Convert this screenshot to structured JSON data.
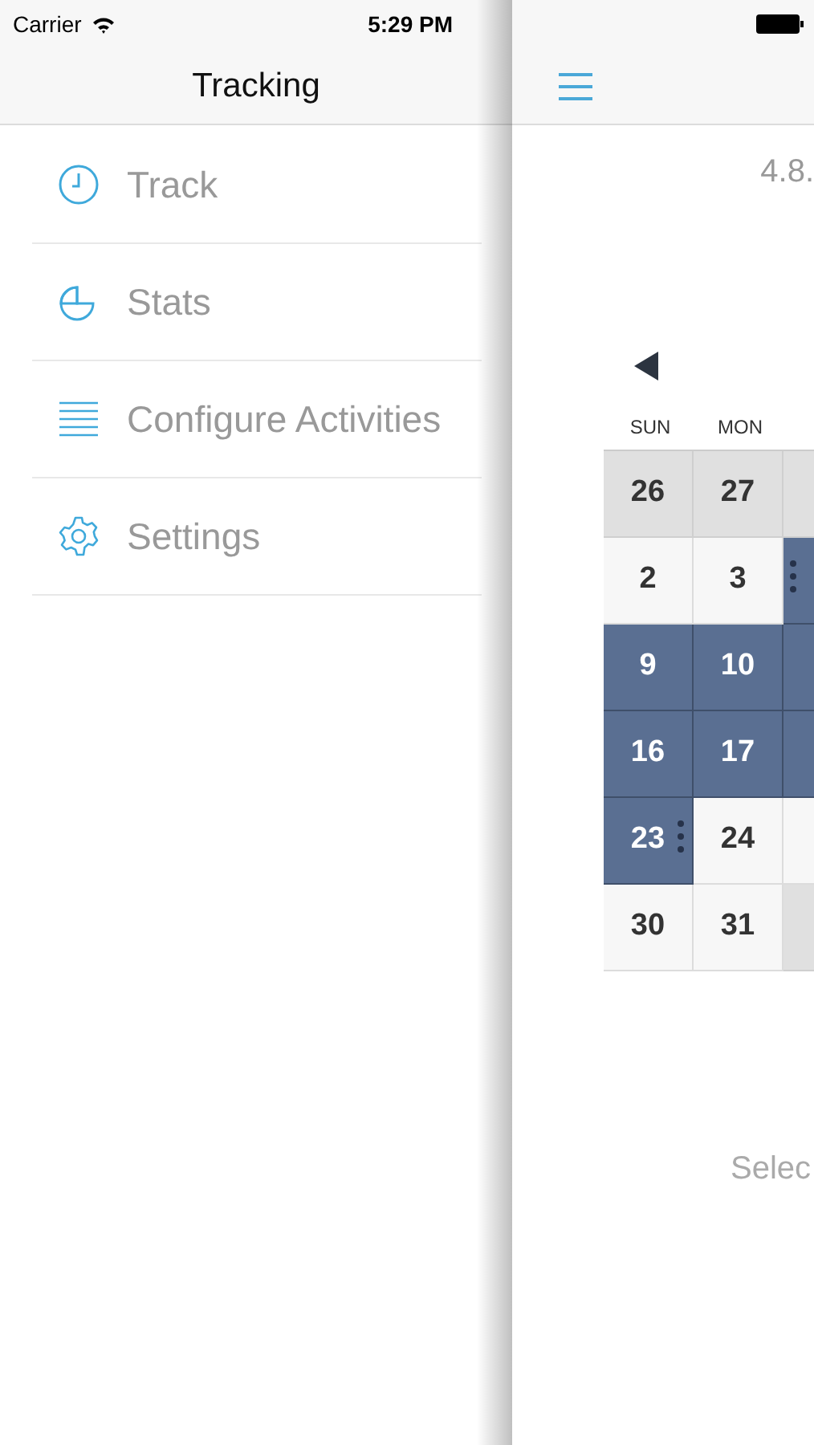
{
  "status_bar": {
    "carrier": "Carrier",
    "time": "5:29 PM"
  },
  "menu": {
    "title": "Tracking",
    "items": [
      {
        "kind": "clock",
        "label": "Track"
      },
      {
        "kind": "pie",
        "label": "Stats"
      },
      {
        "kind": "list",
        "label": "Configure Activities"
      },
      {
        "kind": "gear",
        "label": "Settings"
      }
    ]
  },
  "main": {
    "date_text": "4.8.",
    "weekdays": [
      "SUN",
      "MON"
    ],
    "weeks": [
      [
        {
          "day": "26",
          "kind": "other_month",
          "dots": false
        },
        {
          "day": "27",
          "kind": "other_month",
          "dots": false
        },
        {
          "kind": "other_month",
          "dots": false
        }
      ],
      [
        {
          "day": "2",
          "kind": "day",
          "dots": false
        },
        {
          "day": "3",
          "kind": "day",
          "dots": false
        },
        {
          "kind": "tracked",
          "dots": true
        }
      ],
      [
        {
          "day": "9",
          "kind": "tracked",
          "dots": false
        },
        {
          "day": "10",
          "kind": "tracked",
          "dots": false
        },
        {
          "kind": "tracked",
          "dots": false
        }
      ],
      [
        {
          "day": "16",
          "kind": "tracked",
          "dots": false
        },
        {
          "day": "17",
          "kind": "tracked",
          "dots": false
        },
        {
          "kind": "tracked",
          "dots": false
        }
      ],
      [
        {
          "day": "23",
          "kind": "tracked",
          "dots": true
        },
        {
          "day": "24",
          "kind": "day",
          "dots": false
        },
        {
          "kind": "day",
          "dots": false
        }
      ],
      [
        {
          "day": "30",
          "kind": "day",
          "dots": false
        },
        {
          "day": "31",
          "kind": "day",
          "dots": false
        },
        {
          "kind": "other_month",
          "dots": false
        }
      ]
    ],
    "hint": "Selec"
  }
}
